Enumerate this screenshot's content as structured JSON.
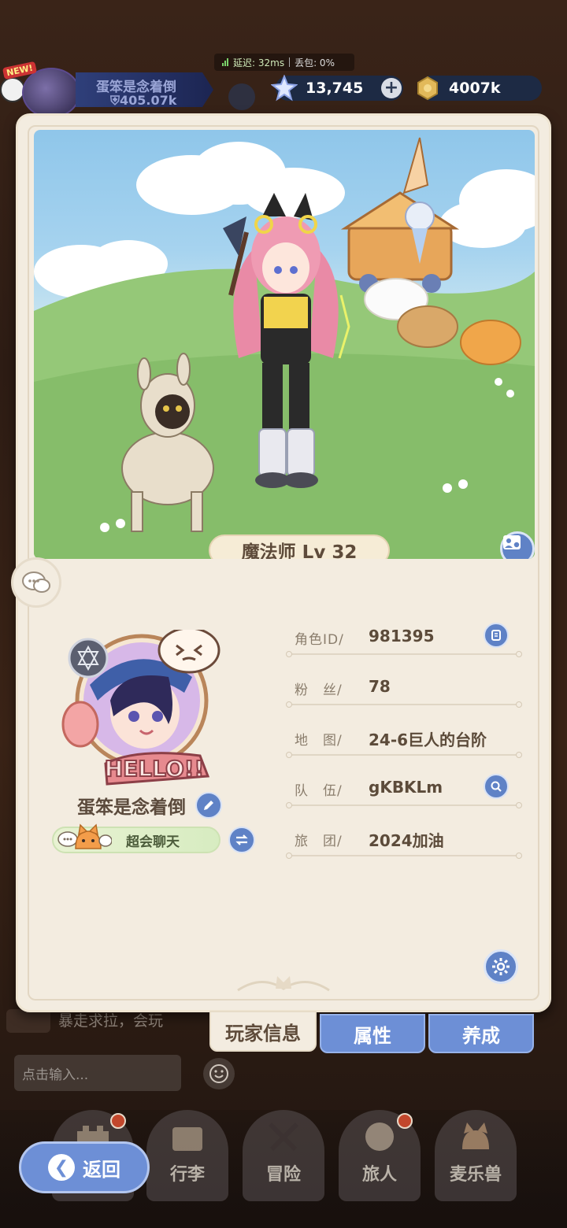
{
  "status": {
    "latency": "延迟: 32ms",
    "loss": "丢包: 0%"
  },
  "player_chip": {
    "new_tag": "NEW!",
    "name": "蛋笨是念着倒",
    "power": "405.07k"
  },
  "currency": {
    "stars": "13,745",
    "gold": "4007k"
  },
  "character": {
    "job_label": "魔法师 Lv 32"
  },
  "profile": {
    "name": "蛋笨是念着倒",
    "title": "超会聊天",
    "avatar_banner": "HELLO!!"
  },
  "info": [
    {
      "key": "角色ID/",
      "value": "981395",
      "icon": "copy-icon"
    },
    {
      "key": "粉　丝/",
      "value": "78",
      "icon": ""
    },
    {
      "key": "地　图/",
      "value": "24-6巨人的台阶",
      "icon": ""
    },
    {
      "key": "队　伍/",
      "value": "gKBKLm",
      "icon": "search-icon"
    },
    {
      "key": "旅　团/",
      "value": "2024加油",
      "icon": ""
    }
  ],
  "tabs": {
    "player_info": "玩家信息",
    "attributes": "属性",
    "cultivate": "养成"
  },
  "background_chat": {
    "message": "暴走求拉，会玩",
    "input_placeholder": "点击输入..."
  },
  "nav": {
    "back": "返回",
    "luggage": "行李",
    "adventure": "冒险",
    "traveler": "旅人",
    "pets": "麦乐兽"
  },
  "colors": {
    "accent_blue": "#6d8fd6",
    "card_bg": "#f3ece0",
    "text_brown": "#5c4b3a"
  }
}
